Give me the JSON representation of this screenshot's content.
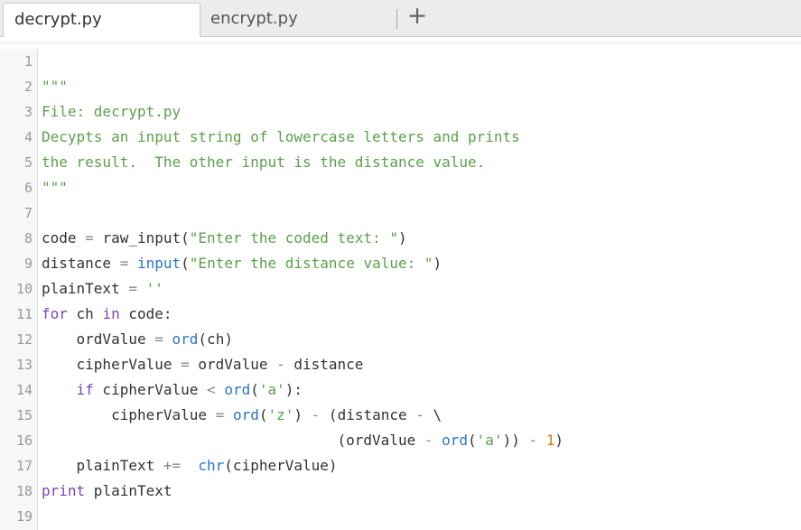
{
  "tabs": [
    {
      "label": "decrypt.py",
      "active": true
    },
    {
      "label": "encrypt.py",
      "active": false
    }
  ],
  "add_tab_glyph": "+",
  "editor": {
    "lines": [
      {
        "n": "1",
        "tokens": []
      },
      {
        "n": "2",
        "tokens": [
          {
            "t": "\"\"\"",
            "k": "str"
          }
        ]
      },
      {
        "n": "3",
        "tokens": [
          {
            "t": "File: decrypt.py",
            "k": "str"
          }
        ]
      },
      {
        "n": "4",
        "tokens": [
          {
            "t": "Decypts an input string of lowercase letters and prints",
            "k": "str"
          }
        ]
      },
      {
        "n": "5",
        "tokens": [
          {
            "t": "the result.  The other input is the distance value.",
            "k": "str"
          }
        ]
      },
      {
        "n": "6",
        "tokens": [
          {
            "t": "\"\"\"",
            "k": "str"
          }
        ]
      },
      {
        "n": "7",
        "tokens": []
      },
      {
        "n": "8",
        "tokens": [
          {
            "t": "code ",
            "k": "id"
          },
          {
            "t": "=",
            "k": "op"
          },
          {
            "t": " raw_input(",
            "k": "id"
          },
          {
            "t": "\"Enter the coded text: \"",
            "k": "str"
          },
          {
            "t": ")",
            "k": "id"
          }
        ]
      },
      {
        "n": "9",
        "tokens": [
          {
            "t": "distance ",
            "k": "id"
          },
          {
            "t": "=",
            "k": "op"
          },
          {
            "t": " ",
            "k": "id"
          },
          {
            "t": "input",
            "k": "fn"
          },
          {
            "t": "(",
            "k": "id"
          },
          {
            "t": "\"Enter the distance value: \"",
            "k": "str"
          },
          {
            "t": ")",
            "k": "id"
          }
        ]
      },
      {
        "n": "10",
        "tokens": [
          {
            "t": "plainText ",
            "k": "id"
          },
          {
            "t": "=",
            "k": "op"
          },
          {
            "t": " ",
            "k": "id"
          },
          {
            "t": "''",
            "k": "str"
          }
        ]
      },
      {
        "n": "11",
        "tokens": [
          {
            "t": "for",
            "k": "kw"
          },
          {
            "t": " ch ",
            "k": "id"
          },
          {
            "t": "in",
            "k": "kw"
          },
          {
            "t": " code:",
            "k": "id"
          }
        ]
      },
      {
        "n": "12",
        "tokens": [
          {
            "t": "    ordValue ",
            "k": "id"
          },
          {
            "t": "=",
            "k": "op"
          },
          {
            "t": " ",
            "k": "id"
          },
          {
            "t": "ord",
            "k": "fn"
          },
          {
            "t": "(ch)",
            "k": "id"
          }
        ]
      },
      {
        "n": "13",
        "tokens": [
          {
            "t": "    cipherValue ",
            "k": "id"
          },
          {
            "t": "=",
            "k": "op"
          },
          {
            "t": " ordValue ",
            "k": "id"
          },
          {
            "t": "-",
            "k": "op"
          },
          {
            "t": " distance",
            "k": "id"
          }
        ]
      },
      {
        "n": "14",
        "tokens": [
          {
            "t": "    ",
            "k": "id"
          },
          {
            "t": "if",
            "k": "kw"
          },
          {
            "t": " cipherValue ",
            "k": "id"
          },
          {
            "t": "<",
            "k": "op"
          },
          {
            "t": " ",
            "k": "id"
          },
          {
            "t": "ord",
            "k": "fn"
          },
          {
            "t": "(",
            "k": "id"
          },
          {
            "t": "'a'",
            "k": "str"
          },
          {
            "t": "):",
            "k": "id"
          }
        ]
      },
      {
        "n": "15",
        "tokens": [
          {
            "t": "        cipherValue ",
            "k": "id"
          },
          {
            "t": "=",
            "k": "op"
          },
          {
            "t": " ",
            "k": "id"
          },
          {
            "t": "ord",
            "k": "fn"
          },
          {
            "t": "(",
            "k": "id"
          },
          {
            "t": "'z'",
            "k": "str"
          },
          {
            "t": ") ",
            "k": "id"
          },
          {
            "t": "-",
            "k": "op"
          },
          {
            "t": " (distance ",
            "k": "id"
          },
          {
            "t": "-",
            "k": "op"
          },
          {
            "t": " \\",
            "k": "id"
          }
        ]
      },
      {
        "n": "16",
        "tokens": [
          {
            "t": "                                  (ordValue ",
            "k": "id"
          },
          {
            "t": "-",
            "k": "op"
          },
          {
            "t": " ",
            "k": "id"
          },
          {
            "t": "ord",
            "k": "fn"
          },
          {
            "t": "(",
            "k": "id"
          },
          {
            "t": "'a'",
            "k": "str"
          },
          {
            "t": ")) ",
            "k": "id"
          },
          {
            "t": "-",
            "k": "op"
          },
          {
            "t": " ",
            "k": "id"
          },
          {
            "t": "1",
            "k": "num"
          },
          {
            "t": ")",
            "k": "id"
          }
        ]
      },
      {
        "n": "17",
        "tokens": [
          {
            "t": "    plainText ",
            "k": "id"
          },
          {
            "t": "+=",
            "k": "op"
          },
          {
            "t": "  ",
            "k": "id"
          },
          {
            "t": "chr",
            "k": "fn"
          },
          {
            "t": "(cipherValue)",
            "k": "id"
          }
        ]
      },
      {
        "n": "18",
        "tokens": [
          {
            "t": "print",
            "k": "kw"
          },
          {
            "t": " plainText",
            "k": "id"
          }
        ]
      },
      {
        "n": "19",
        "tokens": []
      }
    ]
  }
}
